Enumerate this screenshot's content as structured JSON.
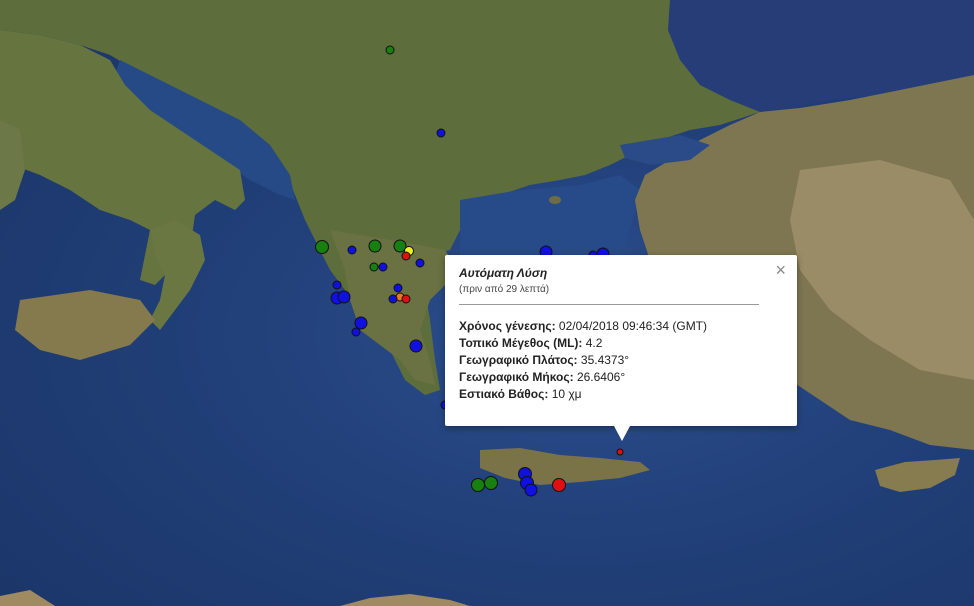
{
  "popup": {
    "title": "Αυτόματη Λύση",
    "subtitle": "(πριν από 29 λεπτά)",
    "close_icon": "×",
    "rows": [
      {
        "label": "Χρόνος γένεσης:",
        "value": "02/04/2018  09:46:34 (GMT)"
      },
      {
        "label": "Τοπικό Μέγεθος (ML):",
        "value": "4.2"
      },
      {
        "label": "Γεωγραφικό Πλάτος:",
        "value": "35.4373°"
      },
      {
        "label": "Γεωγραφικό Μήκος:",
        "value": "26.6406°"
      },
      {
        "label": "Εστιακό Βάθος:",
        "value": "10 χμ"
      }
    ]
  },
  "marker_colors": {
    "green": "#17800f",
    "blue": "#1010e0",
    "red": "#e01010",
    "orange": "#f07818",
    "yellow": "#f5f020"
  },
  "map_colors": {
    "sea_deep": "#1a3466",
    "land_green": "#5d6e3a",
    "land_brown": "#8a7a52",
    "land_light": "#a89870"
  }
}
